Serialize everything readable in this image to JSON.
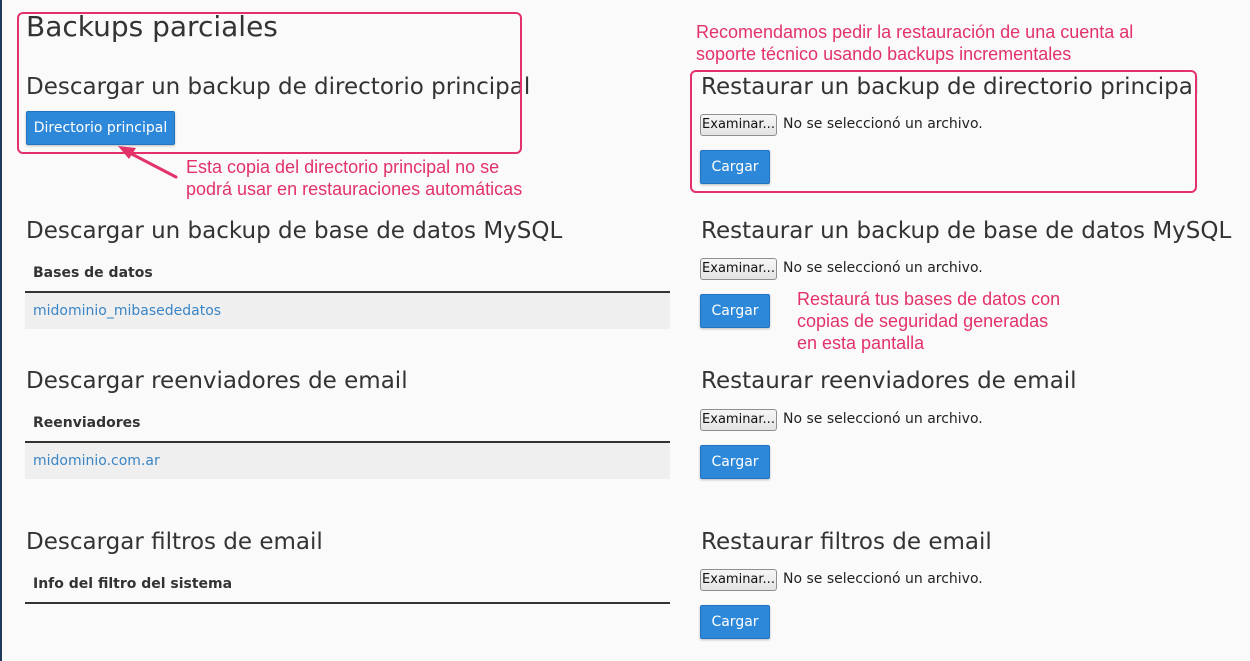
{
  "page_title": "Backups parciales",
  "left": {
    "home_dir": {
      "title": "Descargar un backup de directorio principal",
      "button": "Directorio principal"
    },
    "mysql": {
      "title": "Descargar un backup de base de datos MySQL",
      "column_header": "Bases de datos",
      "rows": [
        "midominio_mibasededatos"
      ]
    },
    "forwarders": {
      "title": "Descargar reenviadores de email",
      "column_header": "Reenviadores",
      "rows": [
        "midominio.com.ar"
      ]
    },
    "filters": {
      "title": "Descargar filtros de email",
      "column_header": "Info del filtro del sistema"
    }
  },
  "right": {
    "home_dir": {
      "title": "Restaurar un backup de directorio principal"
    },
    "mysql": {
      "title": "Restaurar un backup de base de datos MySQL"
    },
    "forwarders": {
      "title": "Restaurar reenviadores de email"
    },
    "filters": {
      "title": "Restaurar filtros de email"
    },
    "file_button": "Examinar...",
    "file_status": "No se seleccionó un archivo.",
    "upload_button": "Cargar"
  },
  "annotations": {
    "top_right": [
      "Recomendamos pedir la restauración de una cuenta al",
      "soporte técnico usando backups incrementales"
    ],
    "home_dir_note": [
      "Esta copia del directorio principal no se",
      "podrá usar en restauraciones automáticas"
    ],
    "mysql_note": [
      "Restaurá tus bases de datos con",
      "copias de seguridad generadas",
      "en esta pantalla"
    ]
  },
  "colors": {
    "accent": "#2d88d9",
    "annotation": "#e3326a",
    "link": "#3a85c6"
  }
}
